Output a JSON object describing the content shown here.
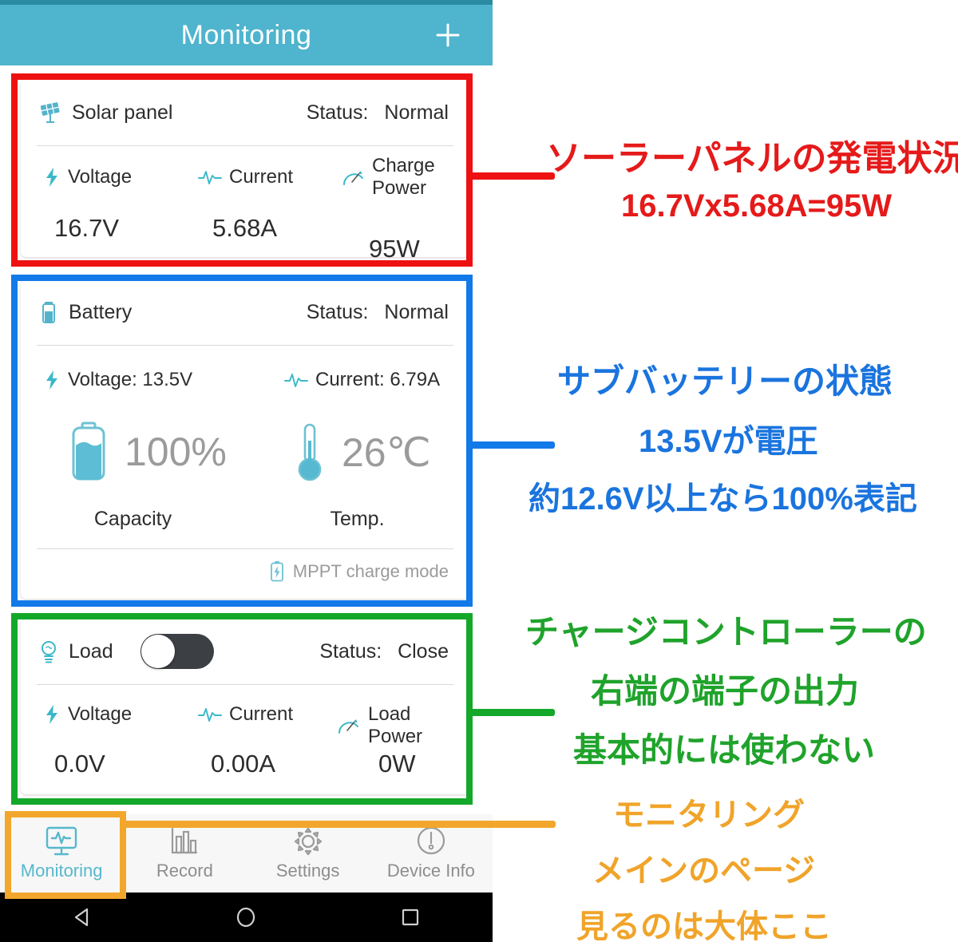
{
  "app": {
    "title": "Monitoring",
    "add_icon": "plus-icon",
    "header_color": "#4fb4cd"
  },
  "solar_card": {
    "icon": "solar-panel-icon",
    "title": "Solar panel",
    "status_label": "Status:",
    "status_value": "Normal",
    "metrics": [
      {
        "icon": "bolt-icon",
        "label": "Voltage",
        "value": "16.7V"
      },
      {
        "icon": "pulse-icon",
        "label": "Current",
        "value": "5.68A"
      },
      {
        "icon": "gauge-icon",
        "label": "Charge Power",
        "value": "95W"
      }
    ]
  },
  "battery_card": {
    "icon": "battery-icon",
    "title": "Battery",
    "status_label": "Status:",
    "status_value": "Normal",
    "voltage_icon": "bolt-icon",
    "voltage_text": "Voltage:  13.5V",
    "current_icon": "pulse-icon",
    "current_text": "Current:  6.79A",
    "capacity_icon": "battery-fill-icon",
    "capacity_value": "100%",
    "capacity_label": "Capacity",
    "temp_icon": "thermometer-icon",
    "temp_value": "26℃",
    "temp_label": "Temp.",
    "mode_icon": "battery-charging-icon",
    "mode_text": "MPPT charge mode"
  },
  "load_card": {
    "icon": "bulb-icon",
    "title": "Load",
    "toggle_state": "off",
    "status_label": "Status:",
    "status_value": "Close",
    "metrics": [
      {
        "icon": "bolt-icon",
        "label": "Voltage",
        "value": "0.0V"
      },
      {
        "icon": "pulse-icon",
        "label": "Current",
        "value": "0.00A"
      },
      {
        "icon": "gauge-icon",
        "label": "Load Power",
        "value": "0W"
      }
    ]
  },
  "tabbar": {
    "items": [
      {
        "icon": "monitor-pulse-icon",
        "label": "Monitoring",
        "active": true
      },
      {
        "icon": "bar-chart-icon",
        "label": "Record",
        "active": false
      },
      {
        "icon": "gear-icon",
        "label": "Settings",
        "active": false
      },
      {
        "icon": "info-circle-icon",
        "label": "Device Info",
        "active": false
      }
    ]
  },
  "system_nav": {
    "back_icon": "triangle-back-icon",
    "home_icon": "circle-home-icon",
    "recents_icon": "square-recents-icon"
  },
  "annotations": {
    "red": {
      "color": "#e51a1a",
      "lines": [
        "ソーラーパネルの発電状況",
        "16.7Vx5.68A=95W"
      ]
    },
    "blue": {
      "color": "#1a74de",
      "lines": [
        "サブバッテリーの状態",
        "13.5Vが電圧",
        "約12.6V以上なら100%表記"
      ]
    },
    "green": {
      "color": "#1fa32b",
      "lines": [
        "チャージコントローラーの",
        "右端の端子の出力",
        "基本的には使わない"
      ]
    },
    "orange": {
      "color": "#f0a42a",
      "lines": [
        "モニタリング",
        "メインのページ",
        "見るのは大体ここ"
      ]
    }
  }
}
